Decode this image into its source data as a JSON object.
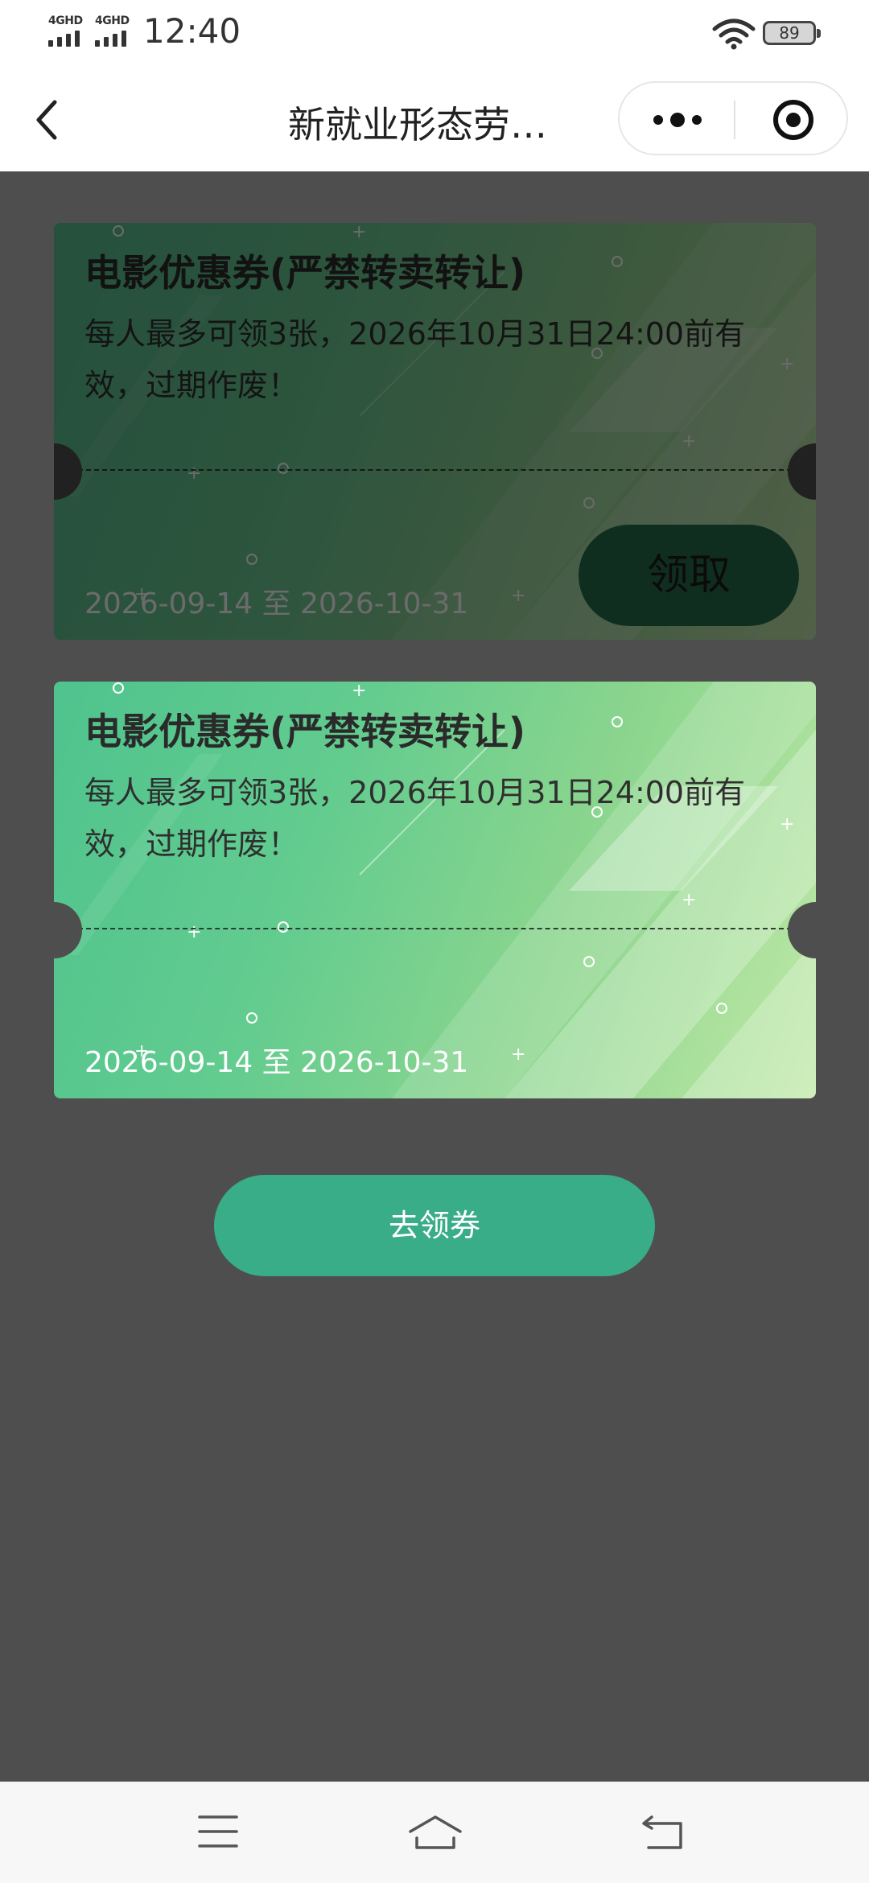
{
  "status_bar": {
    "signal1_label": "4GHD",
    "signal2_label": "4GHD",
    "time": "12:40",
    "battery": "89",
    "icons": [
      "signal-icon",
      "wifi-icon",
      "battery-icon"
    ]
  },
  "nav": {
    "title": "新就业形态劳…",
    "back_icon": "chevron-left-icon",
    "more_icon": "more-dots-icon",
    "close_icon": "target-circle-icon"
  },
  "coupons": [
    {
      "title": "电影优惠券(严禁转卖转让)",
      "description": "每人最多可领3张，2026年10月31日24:00前有效，过期作废！",
      "date_range": "2026-09-14 至 2026-10-31",
      "claim_label": "领取"
    },
    {
      "title": "电影优惠券(严禁转卖转让)",
      "description": "每人最多可领3张，2026年10月31日24:00前有效，过期作废！",
      "date_range": "2026-09-14 至 2026-10-31"
    }
  ],
  "cta": {
    "label": "去领券"
  },
  "system_nav": {
    "icons": [
      "menu-icon",
      "home-icon",
      "back-icon"
    ]
  },
  "colors": {
    "overlay": "#4e4e4e",
    "coupon_gradient_start": "#4fc38e",
    "coupon_gradient_end": "#bfe8a6",
    "cta": "#39ad87",
    "claim_button": "#1f6f4a"
  }
}
